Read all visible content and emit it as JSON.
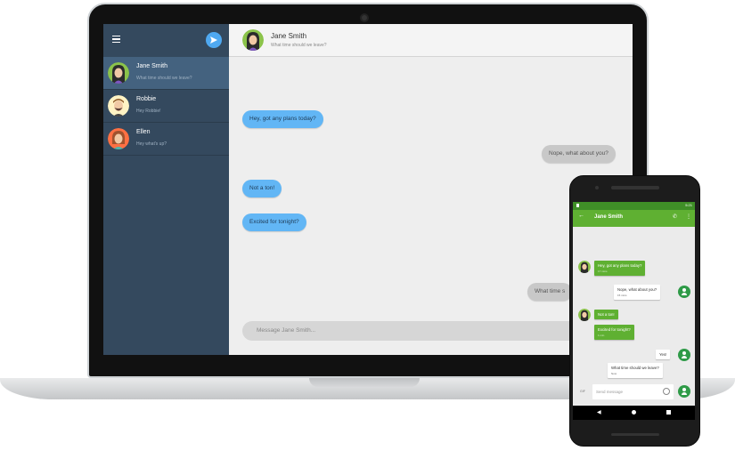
{
  "colors": {
    "sidebar_bg": "#34495e",
    "sidebar_active": "#44627f",
    "incoming_bubble": "#62b6f5",
    "outgoing_bubble": "#c8c8c8",
    "phone_appbar": "#5fb032",
    "accent_send": "#4fa9f1"
  },
  "desktop": {
    "sidebar": {
      "menu_icon": "menu-icon",
      "compose_icon": "send-icon",
      "contacts": [
        {
          "name": "Jane Smith",
          "last_message": "What time should we leave?",
          "active": true
        },
        {
          "name": "Robbie",
          "last_message": "Hey Robbie!",
          "active": false
        },
        {
          "name": "Ellen",
          "last_message": "Hey what's up?",
          "active": false
        }
      ]
    },
    "chat": {
      "contact_name": "Jane Smith",
      "contact_status": "What time should we leave?",
      "messages": [
        {
          "direction": "in",
          "text": "Hey, got any plans today?"
        },
        {
          "direction": "out",
          "text": "Nope, what about you?"
        },
        {
          "direction": "in",
          "text": "Not a ton!"
        },
        {
          "direction": "in",
          "text": "Excited for tonight?"
        },
        {
          "direction": "out",
          "text": "What time s"
        }
      ],
      "input_placeholder": "Message Jane Smith..."
    }
  },
  "phone": {
    "status_time": "5:21",
    "title": "Jane Smith",
    "messages": [
      {
        "direction": "in",
        "text": "Hey, got any plans today?",
        "time": "17 mins"
      },
      {
        "direction": "out",
        "text": "Nope, what about you?",
        "time": "15 mins"
      },
      {
        "direction": "in",
        "text": "Not a ton!",
        "time": ""
      },
      {
        "direction": "in",
        "text": "Excited for tonight?",
        "time": "1 min"
      },
      {
        "direction": "out",
        "text": "Yes!",
        "time": ""
      },
      {
        "direction": "out",
        "text": "What time should we leave?",
        "time": "Now"
      }
    ],
    "input_placeholder": "Send message",
    "gif_label": "GIF"
  }
}
